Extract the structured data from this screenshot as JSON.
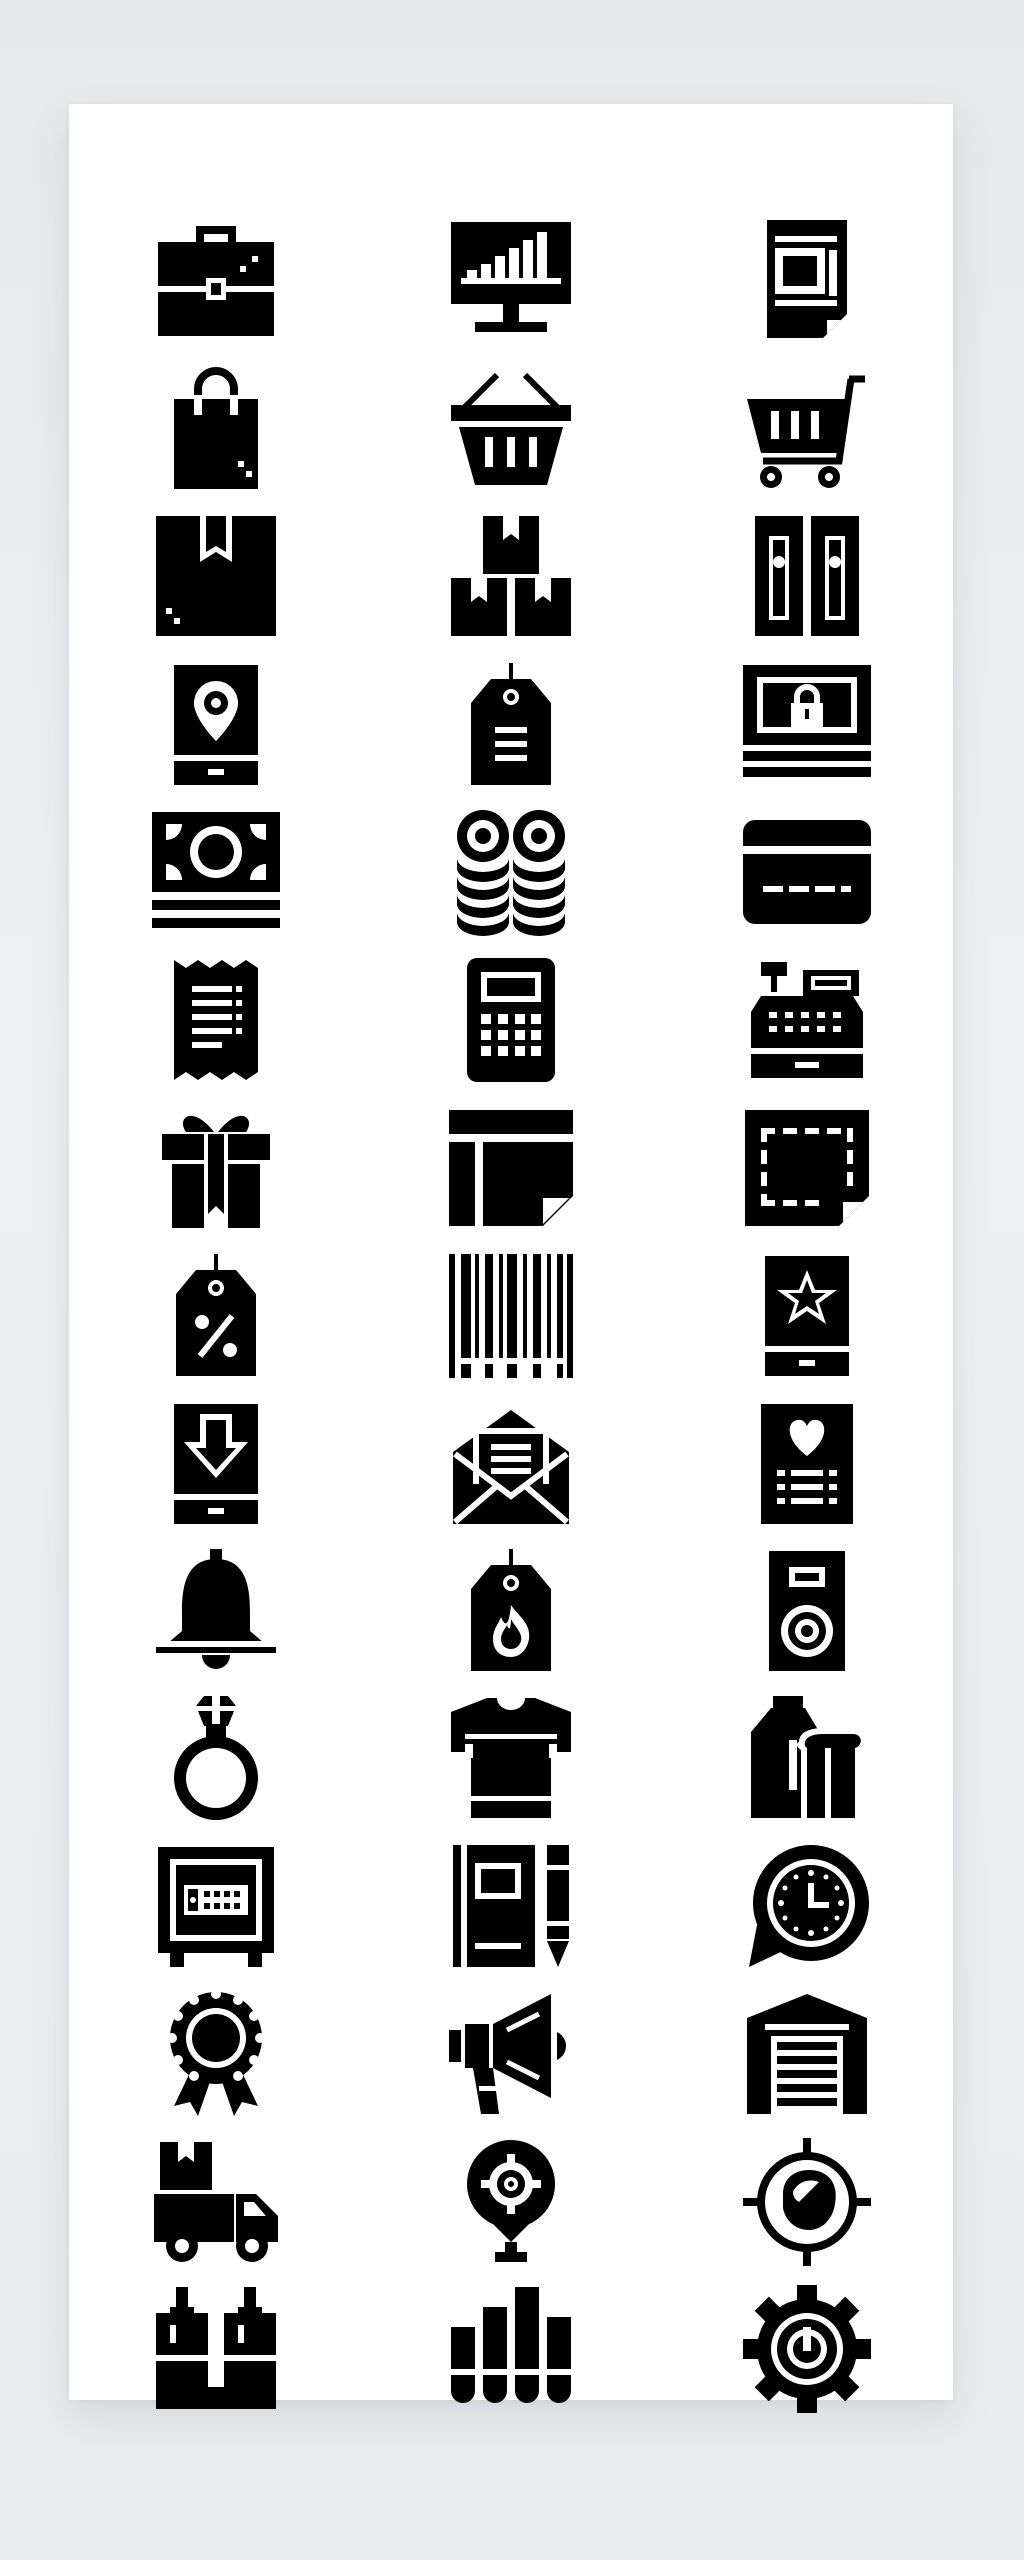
{
  "icon_set": {
    "style": "solid",
    "color": "#000000",
    "background": "#ffffff",
    "columns": 3,
    "icons": [
      "briefcase-icon",
      "monitor-chart-icon",
      "document-icon",
      "shopping-bag-icon",
      "shopping-basket-icon",
      "shopping-cart-icon",
      "box-icon",
      "stacked-boxes-icon",
      "binders-icon",
      "location-tablet-icon",
      "price-tag-icon",
      "money-lock-icon",
      "banknotes-icon",
      "coin-stacks-icon",
      "credit-card-icon",
      "receipt-icon",
      "calculator-icon",
      "cash-register-icon",
      "gift-icon",
      "flyer-icon",
      "coupon-icon",
      "discount-tag-icon",
      "barcode-icon",
      "favorite-tablet-icon",
      "download-tablet-icon",
      "mail-letter-icon",
      "wishlist-document-icon",
      "bell-icon",
      "hot-tag-icon",
      "speaker-icon",
      "ring-icon",
      "shirt-icon",
      "grocery-icon",
      "safe-icon",
      "notebook-pen-icon",
      "clock-chat-icon",
      "award-badge-icon",
      "megaphone-icon",
      "warehouse-icon",
      "delivery-truck-icon",
      "location-gear-icon",
      "target-icon",
      "perfume-icon",
      "cylinders-icon",
      "power-gear-icon"
    ]
  }
}
